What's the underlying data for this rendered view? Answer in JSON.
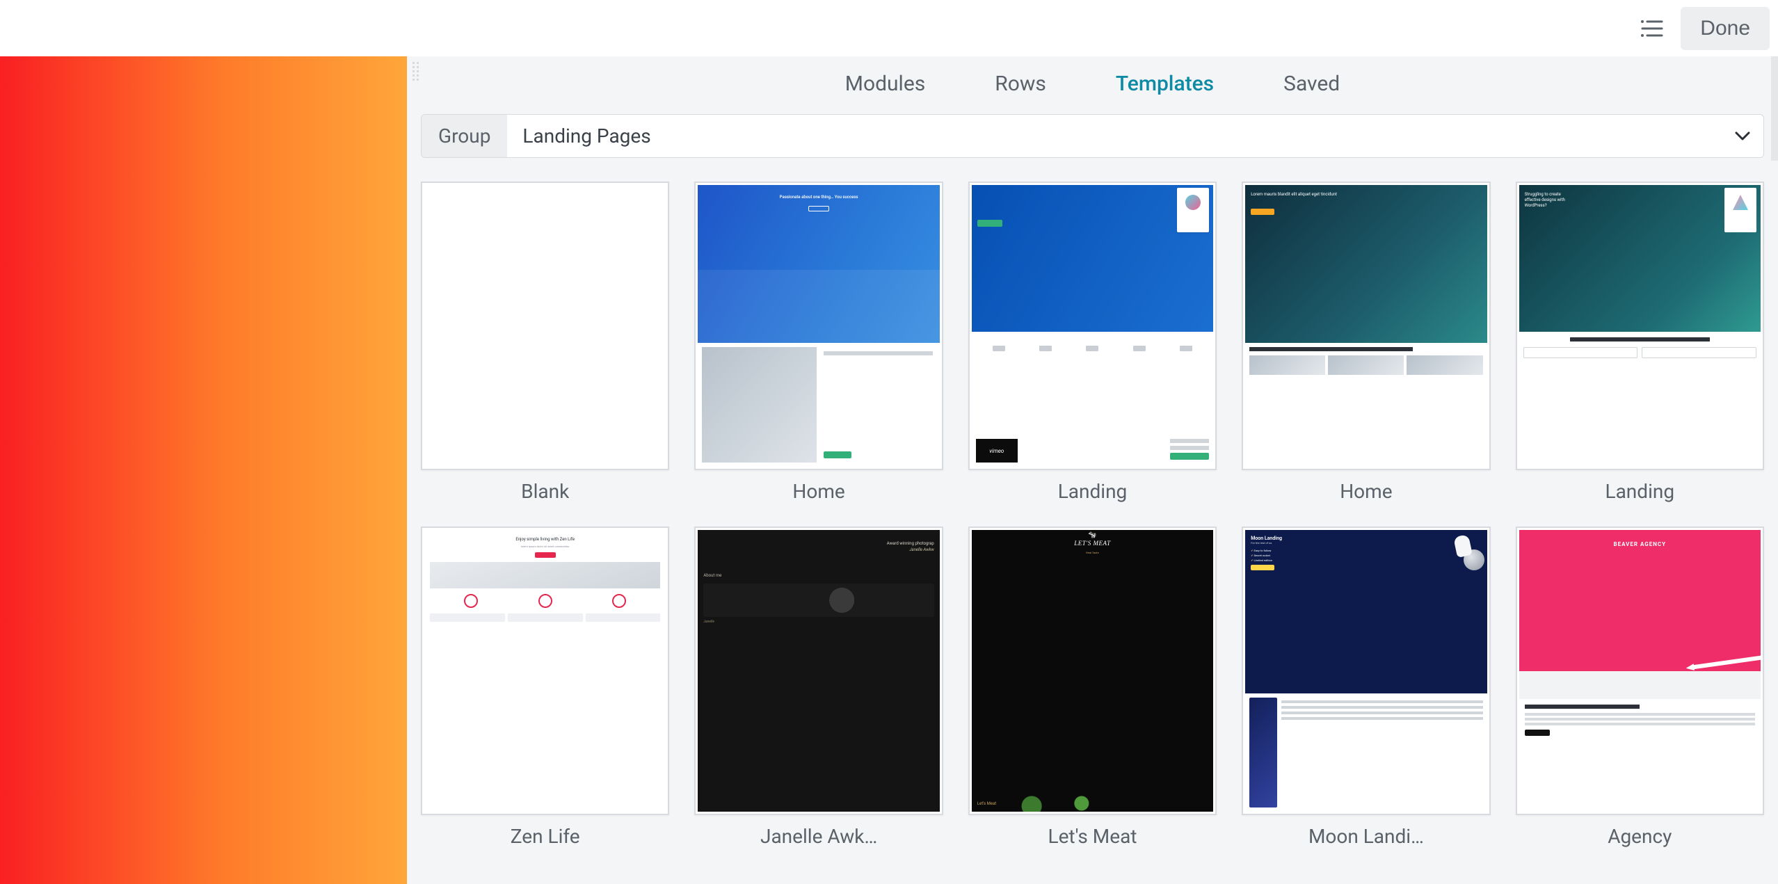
{
  "topbar": {
    "done_label": "Done"
  },
  "panel": {
    "tabs": [
      {
        "id": "modules",
        "label": "Modules",
        "active": false
      },
      {
        "id": "rows",
        "label": "Rows",
        "active": false
      },
      {
        "id": "templates",
        "label": "Templates",
        "active": true
      },
      {
        "id": "saved",
        "label": "Saved",
        "active": false
      }
    ],
    "group": {
      "label": "Group",
      "value": "Landing Pages"
    },
    "templates": [
      {
        "id": "blank",
        "label": "Blank",
        "thumb": "t-blank"
      },
      {
        "id": "home1",
        "label": "Home",
        "thumb": "t-home1"
      },
      {
        "id": "landing1",
        "label": "Landing",
        "thumb": "t-landing1"
      },
      {
        "id": "home2",
        "label": "Home",
        "thumb": "t-home2"
      },
      {
        "id": "landing2",
        "label": "Landing",
        "thumb": "t-landing2"
      },
      {
        "id": "zen",
        "label": "Zen Life",
        "thumb": "t-zen"
      },
      {
        "id": "janelle",
        "label": "Janelle Awk…",
        "thumb": "t-jan"
      },
      {
        "id": "meat",
        "label": "Let's Meat",
        "thumb": "t-meat"
      },
      {
        "id": "moon",
        "label": "Moon Landi…",
        "thumb": "t-moon"
      },
      {
        "id": "agency",
        "label": "Agency",
        "thumb": "t-ag"
      }
    ]
  },
  "thumb_text": {
    "home1_hero": "Passionate about one thing… You success",
    "home2_hero": "Lorem mauris blandit elit aliquet eget tincidunt",
    "landing2_hero": "Struggling to create effective designs with WordPress?",
    "zen_h": "Enjoy simple living with Zen Life",
    "jan_h": "Award winning photograp",
    "jan_n": "Janelle Awkw",
    "jan_about": "About me",
    "meat_logo": "LET'S MEAT",
    "meat_bot": "Let's Meat",
    "moon_h": "Moon Landing",
    "moon_s": "For the rest of us",
    "ag_h": "BEAVER AGENCY"
  }
}
